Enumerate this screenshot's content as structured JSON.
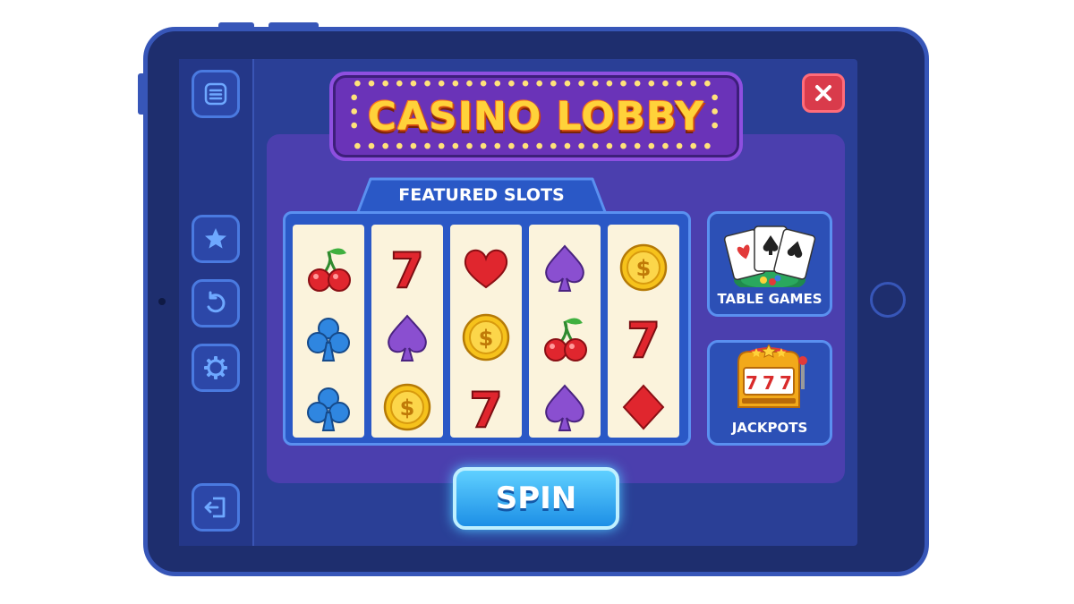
{
  "header": {
    "title": "CASINO LOBBY"
  },
  "sidebar": {
    "items": [
      {
        "icon": "menu-icon"
      },
      {
        "icon": "star-icon"
      },
      {
        "icon": "undo-icon"
      },
      {
        "icon": "gear-icon"
      },
      {
        "icon": "exit-icon"
      }
    ]
  },
  "featured": {
    "label": "FEATURED SLOTS",
    "reels": [
      [
        "cherry",
        "club",
        "club"
      ],
      [
        "seven",
        "spade",
        "coin"
      ],
      [
        "heart",
        "coin",
        "seven"
      ],
      [
        "spade",
        "cherry",
        "spade"
      ],
      [
        "coin",
        "seven",
        "diamond"
      ]
    ]
  },
  "categories": [
    {
      "label": "TABLE GAMES",
      "icon": "cards-icon"
    },
    {
      "label": "JACKPOTS",
      "icon": "slot-machine-icon"
    }
  ],
  "actions": {
    "spin_label": "SPIN",
    "close_icon": "close-icon"
  },
  "colors": {
    "accent": "#ffd23a",
    "spin": "#1d8fe6",
    "close": "#d93b4b",
    "panel": "#4b3fae"
  }
}
